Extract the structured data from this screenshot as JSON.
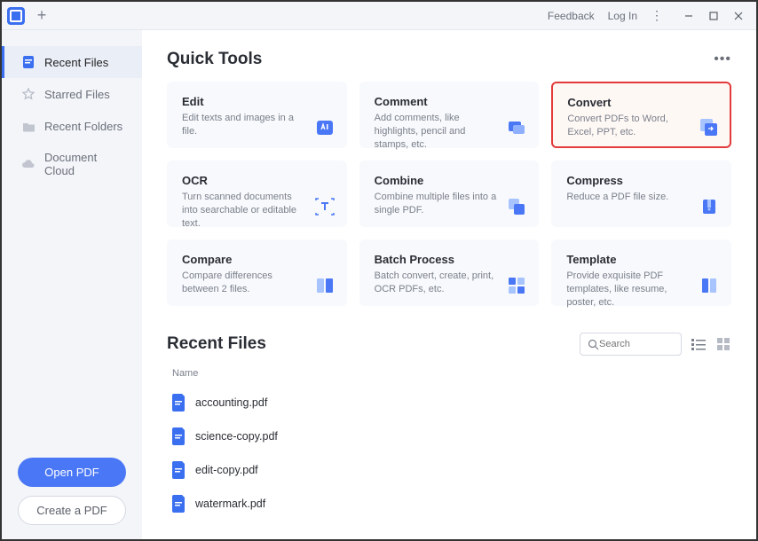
{
  "titlebar": {
    "feedback": "Feedback",
    "login": "Log In"
  },
  "sidebar": {
    "items": [
      {
        "label": "Recent Files"
      },
      {
        "label": "Starred Files"
      },
      {
        "label": "Recent Folders"
      },
      {
        "label": "Document Cloud"
      }
    ],
    "open_pdf": "Open PDF",
    "create_pdf": "Create a PDF"
  },
  "quick_tools": {
    "title": "Quick Tools",
    "cards": [
      {
        "title": "Edit",
        "desc": "Edit texts and images in a file."
      },
      {
        "title": "Comment",
        "desc": "Add comments, like highlights, pencil and stamps, etc."
      },
      {
        "title": "Convert",
        "desc": "Convert PDFs to Word, Excel, PPT, etc."
      },
      {
        "title": "OCR",
        "desc": "Turn scanned documents into searchable or editable text."
      },
      {
        "title": "Combine",
        "desc": "Combine multiple files into a single PDF."
      },
      {
        "title": "Compress",
        "desc": "Reduce a PDF file size."
      },
      {
        "title": "Compare",
        "desc": "Compare differences between 2 files."
      },
      {
        "title": "Batch Process",
        "desc": "Batch convert, create, print, OCR PDFs, etc."
      },
      {
        "title": "Template",
        "desc": "Provide exquisite PDF templates, like resume, poster, etc."
      }
    ]
  },
  "recent": {
    "title": "Recent Files",
    "search_placeholder": "Search",
    "col_name": "Name",
    "files": [
      {
        "name": "accounting.pdf"
      },
      {
        "name": "science-copy.pdf"
      },
      {
        "name": "edit-copy.pdf"
      },
      {
        "name": "watermark.pdf"
      }
    ]
  }
}
